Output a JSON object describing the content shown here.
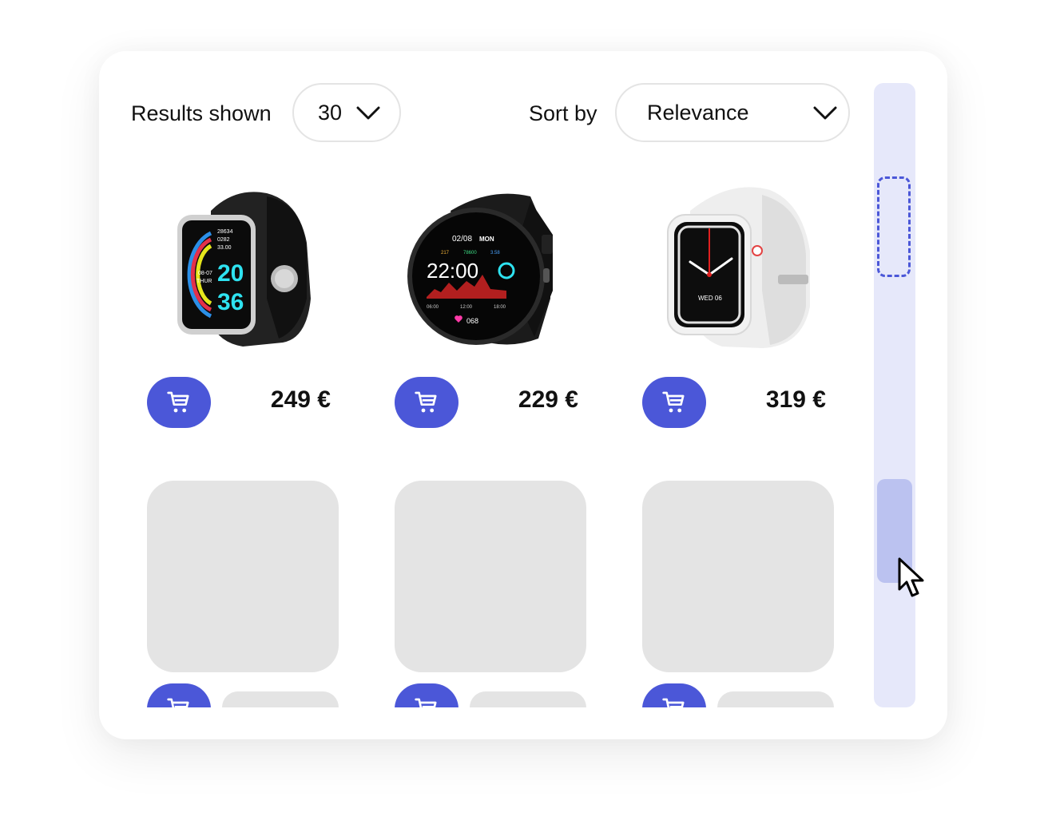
{
  "toolbar": {
    "results_label": "Results shown",
    "results_value": "30",
    "sort_label": "Sort by",
    "sort_value": "Relevance"
  },
  "products": [
    {
      "name": "Square black smartwatch",
      "screen": {
        "steps": "28634",
        "kcal": "0282",
        "dist": "33.00",
        "date": "08-07",
        "day": "THUR",
        "hour": "20",
        "minute": "36"
      },
      "price": "249 €",
      "cart_icon": "cart-icon"
    },
    {
      "name": "Round black smartwatch",
      "screen": {
        "date": "02/08",
        "day": "MON",
        "stat1": "217",
        "stat2": "78600",
        "stat3": "3.58",
        "time": "22:00",
        "t1": "06:00",
        "t2": "12:00",
        "t3": "18:00",
        "hr": "068"
      },
      "price": "229 €",
      "cart_icon": "cart-icon"
    },
    {
      "name": "White square smartwatch",
      "screen": {
        "date": "WED 06"
      },
      "price": "319 €",
      "cart_icon": "cart-icon"
    }
  ],
  "placeholders": [
    {
      "state": "loading"
    },
    {
      "state": "loading"
    },
    {
      "state": "loading"
    }
  ],
  "scrollbar": {
    "thumb_position_fraction": 0.64,
    "ghost_position_fraction": 0.15
  },
  "colors": {
    "accent": "#4b57d8",
    "track": "#e6e8fa",
    "thumb": "#bbc2f0",
    "skeleton": "#e4e4e4"
  }
}
